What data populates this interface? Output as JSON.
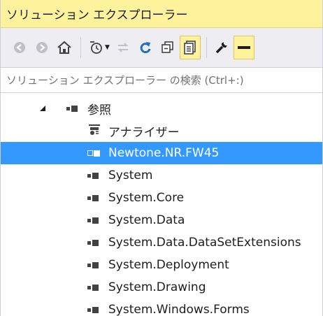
{
  "title": "ソリューション エクスプローラー",
  "toolbar": {
    "buttons": [
      {
        "icon": "back-icon"
      },
      {
        "icon": "forward-icon"
      },
      {
        "icon": "home-icon"
      },
      {
        "icon": "pending-changes-filter-icon"
      },
      {
        "icon": "sync-with-active-document-icon"
      },
      {
        "icon": "refresh-icon"
      },
      {
        "icon": "collapse-all-icon"
      },
      {
        "icon": "show-all-files-icon"
      },
      {
        "icon": "properties-icon"
      },
      {
        "icon": "preview-selected-items-icon"
      }
    ]
  },
  "search": {
    "placeholder": "ソリューション エクスプローラー の検索 (Ctrl+:)"
  },
  "tree": {
    "root": "参照",
    "analyzer": "アナライザー",
    "selected": "Newtone.NR.FW45",
    "references": [
      "System",
      "System.Core",
      "System.Data",
      "System.Data.DataSetExtensions",
      "System.Deployment",
      "System.Drawing",
      "System.Windows.Forms"
    ]
  },
  "colors": {
    "title_bar": "#fff29d",
    "selection": "#3399ff",
    "toolbar_bg": "#eeeef2"
  }
}
